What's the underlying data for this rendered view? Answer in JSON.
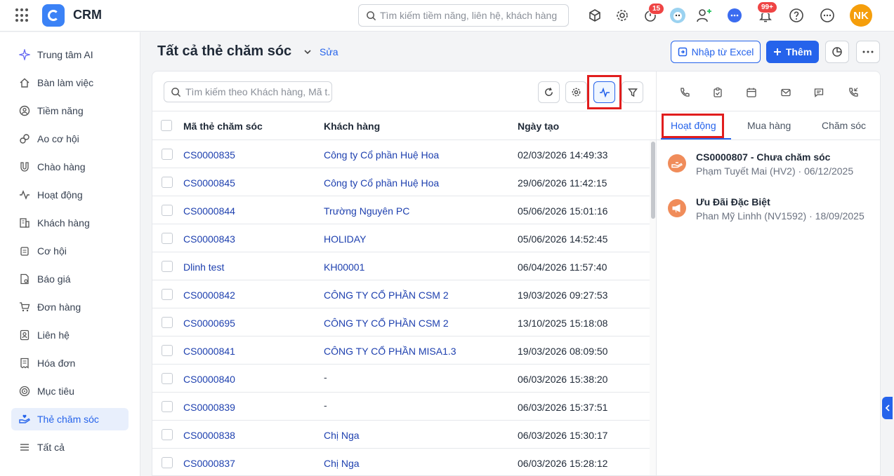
{
  "app": {
    "title": "CRM"
  },
  "topbar": {
    "search_placeholder": "Tìm kiếm tiềm năng, liên hệ, khách hàng",
    "timer_badge": "15",
    "bell_badge": "99+",
    "avatar_initials": "NK"
  },
  "sidebar": {
    "items": [
      {
        "label": "Trung tâm AI",
        "icon": "sparkle-icon"
      },
      {
        "label": "Bàn làm việc",
        "icon": "home-icon"
      },
      {
        "label": "Tiềm năng",
        "icon": "target-person-icon"
      },
      {
        "label": "Ao cơ hội",
        "icon": "link-icon"
      },
      {
        "label": "Chào hàng",
        "icon": "magnet-icon"
      },
      {
        "label": "Hoạt động",
        "icon": "pulse-icon"
      },
      {
        "label": "Khách hàng",
        "icon": "building-icon"
      },
      {
        "label": "Cơ hội",
        "icon": "clipboard-icon"
      },
      {
        "label": "Báo giá",
        "icon": "quote-doc-icon"
      },
      {
        "label": "Đơn hàng",
        "icon": "cart-icon"
      },
      {
        "label": "Liên hệ",
        "icon": "contact-card-icon"
      },
      {
        "label": "Hóa đơn",
        "icon": "invoice-icon"
      },
      {
        "label": "Mục tiêu",
        "icon": "goal-icon"
      },
      {
        "label": "Thẻ chăm sóc",
        "icon": "care-hand-icon",
        "active": true
      },
      {
        "label": "Tất cả",
        "icon": "menu-icon"
      }
    ]
  },
  "header": {
    "title": "Tất cả thẻ chăm sóc",
    "edit_label": "Sửa",
    "import_label": "Nhập từ Excel",
    "add_label": "Thêm"
  },
  "list": {
    "search_placeholder": "Tìm kiếm theo Khách hàng, Mã t...",
    "columns": [
      "Mã thẻ chăm sóc",
      "Khách hàng",
      "Ngày tạo"
    ],
    "rows": [
      {
        "code": "CS0000835",
        "customer": "Công ty Cổ phần Huệ Hoa",
        "date": "02/03/2026 14:49:33"
      },
      {
        "code": "CS0000845",
        "customer": "Công ty Cổ phần Huệ Hoa",
        "date": "29/06/2026 11:42:15"
      },
      {
        "code": "CS0000844",
        "customer": "Trường Nguyên PC",
        "date": "05/06/2026 15:01:16"
      },
      {
        "code": "CS0000843",
        "customer": "HOLIDAY",
        "date": "05/06/2026 14:52:45"
      },
      {
        "code": "Dlinh test",
        "customer": "KH00001",
        "date": "06/04/2026 11:57:40"
      },
      {
        "code": "CS0000842",
        "customer": "CÔNG TY CỔ PHẦN CSM 2",
        "date": "19/03/2026 09:27:53"
      },
      {
        "code": "CS0000695",
        "customer": "CÔNG TY CỔ PHẦN CSM 2",
        "date": "13/10/2025 15:18:08"
      },
      {
        "code": "CS0000841",
        "customer": "CÔNG TY CỔ PHẦN MISA1.3",
        "date": "19/03/2026 08:09:50"
      },
      {
        "code": "CS0000840",
        "customer": "-",
        "date": "06/03/2026 15:38:20"
      },
      {
        "code": "CS0000839",
        "customer": "-",
        "date": "06/03/2026 15:37:51"
      },
      {
        "code": "CS0000838",
        "customer": "Chị Nga",
        "date": "06/03/2026 15:30:17"
      },
      {
        "code": "CS0000837",
        "customer": "Chị Nga",
        "date": "06/03/2026 15:28:12"
      }
    ]
  },
  "right_panel": {
    "tabs": [
      "Hoạt động",
      "Mua hàng",
      "Chăm sóc"
    ],
    "activities": [
      {
        "title": "CS0000807 - Chưa chăm sóc",
        "person": "Phạm Tuyết Mai (HV2)",
        "date": "06/12/2025"
      },
      {
        "title": "Ưu Đãi Đặc Biệt",
        "person": "Phan Mỹ Linhh (NV1592)",
        "date": "18/09/2025"
      }
    ]
  },
  "colors": {
    "accent": "#2563eb",
    "highlight": "#e11d1d",
    "activity_icon": "#f08c5a",
    "avatar": "#f59e0b"
  }
}
